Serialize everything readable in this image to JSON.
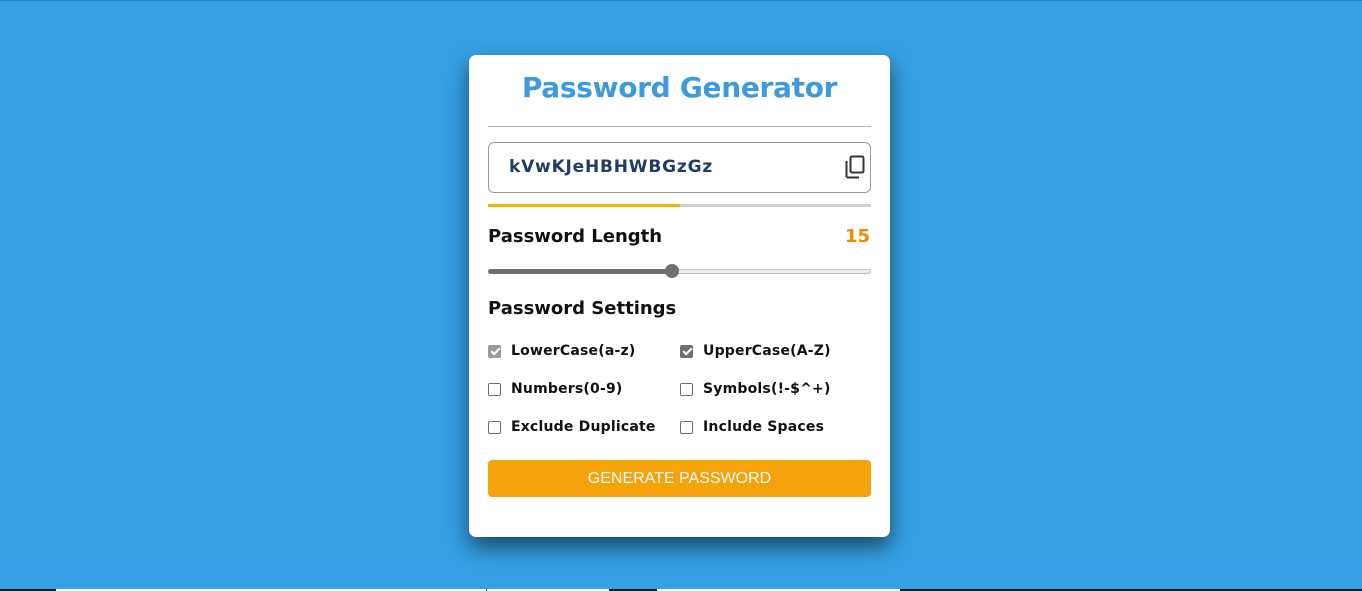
{
  "app": {
    "title": "Password Generator"
  },
  "password": {
    "value": "kVwKJeHBHWBGzGz",
    "strength_fraction": 0.5
  },
  "length": {
    "label": "Password Length",
    "value": "15",
    "slider_fraction": 0.48
  },
  "settings": {
    "label": "Password Settings",
    "options": [
      {
        "label": "LowerCase(a-z)",
        "checked": true
      },
      {
        "label": "UpperCase(A-Z)",
        "checked": true
      },
      {
        "label": "Numbers(0-9)",
        "checked": false
      },
      {
        "label": "Symbols(!-$^+)",
        "checked": false
      },
      {
        "label": "Exclude Duplicate",
        "checked": false
      },
      {
        "label": "Include Spaces",
        "checked": false
      }
    ]
  },
  "actions": {
    "generate_label": "GENERATE PASSWORD"
  },
  "colors": {
    "background": "#35a0e4",
    "title": "#3d9ae0",
    "accent": "#f6a20a",
    "length_value": "#f08a00",
    "strength": "#f6b400",
    "password_text": "#1f3c63"
  },
  "icons": {
    "copy": "copy-icon"
  }
}
